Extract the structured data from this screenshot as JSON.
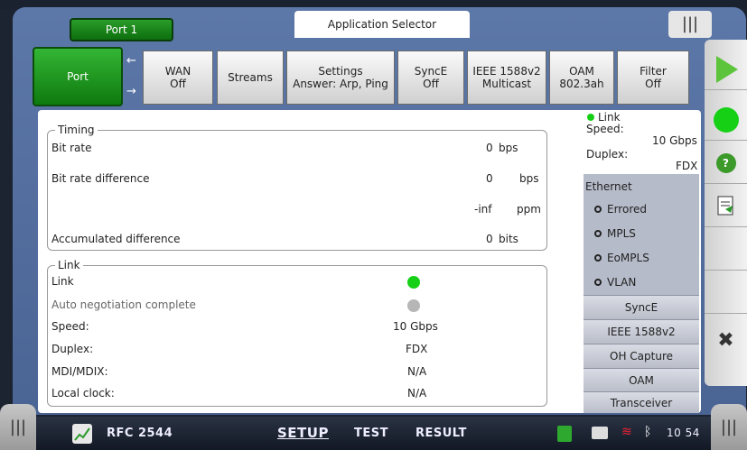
{
  "header": {
    "port_tab": "Port 1",
    "app_selector": "Application Selector"
  },
  "tabs": [
    {
      "line1": "Port",
      "line2": ""
    },
    {
      "line1": "WAN",
      "line2": "Off"
    },
    {
      "line1": "Streams",
      "line2": ""
    },
    {
      "line1": "Settings",
      "line2": "Answer: Arp, Ping"
    },
    {
      "line1": "SyncE",
      "line2": "Off"
    },
    {
      "line1": "IEEE 1588v2",
      "line2": "Multicast"
    },
    {
      "line1": "OAM",
      "line2": "802.3ah"
    },
    {
      "line1": "Filter",
      "line2": "Off"
    }
  ],
  "timing": {
    "legend": "Timing",
    "bit_rate_label": "Bit rate",
    "bit_rate_value": "0",
    "bit_rate_unit": "bps",
    "bit_rate_diff_label": "Bit rate difference",
    "bit_rate_diff_value": "0",
    "bit_rate_diff_unit": "bps",
    "ppm_value": "-inf",
    "ppm_unit": "ppm",
    "acc_diff_label": "Accumulated difference",
    "acc_diff_value": "0",
    "acc_diff_unit": "bits"
  },
  "link": {
    "legend": "Link",
    "link_label": "Link",
    "autoneg_label": "Auto negotiation complete",
    "speed_label": "Speed:",
    "speed_value": "10 Gbps",
    "duplex_label": "Duplex:",
    "duplex_value": "FDX",
    "mdi_label": "MDI/MDIX:",
    "mdi_value": "N/A",
    "clock_label": "Local clock:",
    "clock_value": "N/A"
  },
  "status": {
    "link_label": "Link",
    "speed_label": "Speed:",
    "speed_value": "10 Gbps",
    "duplex_label": "Duplex:",
    "duplex_value": "FDX",
    "ethernet_label": "Ethernet"
  },
  "side": {
    "radios": [
      "Errored",
      "MPLS",
      "EoMPLS",
      "VLAN"
    ],
    "buttons": [
      "SyncE",
      "IEEE 1588v2",
      "OH Capture",
      "OAM",
      "Transceiver"
    ]
  },
  "bottom": {
    "test_name": "RFC 2544",
    "nav_setup": "SETUP",
    "nav_test": "TEST",
    "nav_result": "RESULT",
    "time": "10 54"
  },
  "colors": {
    "accent_green": "#16d016",
    "frame_blue": "#5c78a8"
  }
}
